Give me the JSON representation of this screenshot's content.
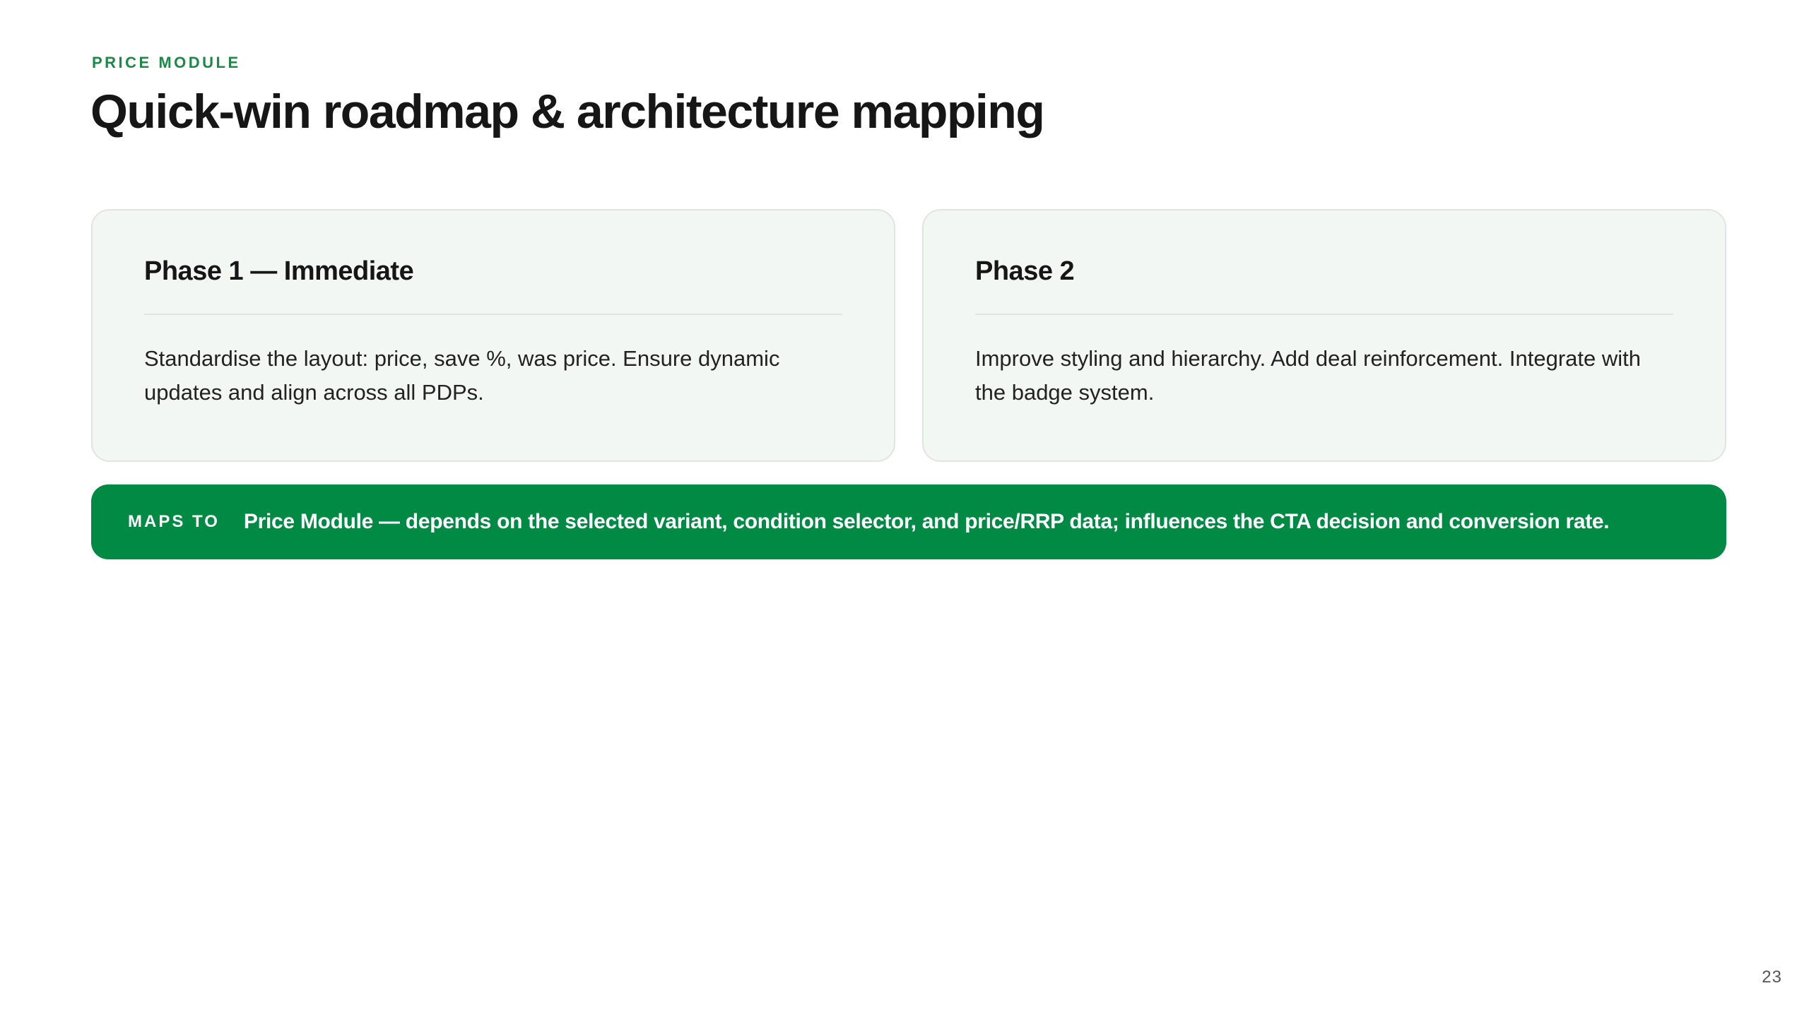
{
  "header": {
    "eyebrow": "PRICE MODULE",
    "title": "Quick-win roadmap & architecture mapping"
  },
  "phases": [
    {
      "title": "Phase 1 — Immediate",
      "body": "Standardise the layout: price, save %, was price. Ensure dynamic updates and align across all PDPs."
    },
    {
      "title": "Phase 2",
      "body": "Improve styling and hierarchy. Add deal reinforcement. Integrate with the badge system."
    }
  ],
  "maps_to": {
    "label": "MAPS TO",
    "text": "Price Module — depends on the selected variant, condition selector, and price/RRP data; influences the CTA decision and conversion rate."
  },
  "footer": {
    "page_number": "23"
  },
  "colors": {
    "accent": "#008a43",
    "card_background": "#f3f7f3"
  }
}
